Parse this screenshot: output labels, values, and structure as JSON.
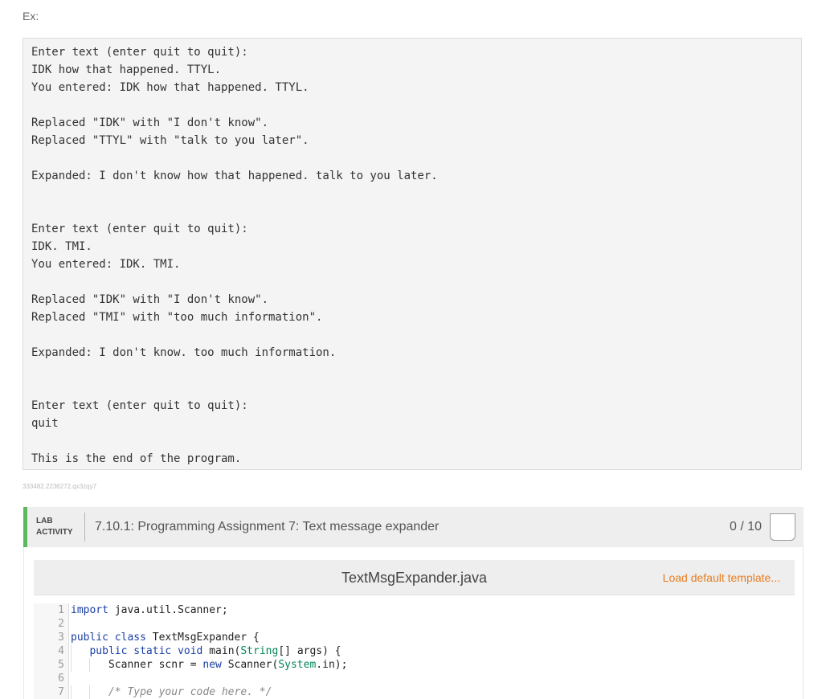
{
  "example_label": "Ex:",
  "console_lines": [
    "Enter text (enter quit to quit):",
    "IDK how that happened. TTYL.",
    "You entered: IDK how that happened. TTYL.",
    "",
    "Replaced \"IDK\" with \"I don't know\".",
    "Replaced \"TTYL\" with \"talk to you later\".",
    "",
    "Expanded: I don't know how that happened. talk to you later.",
    "",
    "",
    "Enter text (enter quit to quit):",
    "IDK. TMI.",
    "You entered: IDK. TMI.",
    "",
    "Replaced \"IDK\" with \"I don't know\".",
    "Replaced \"TMI\" with \"too much information\".",
    "",
    "Expanded: I don't know. too much information.",
    "",
    "",
    "Enter text (enter quit to quit):",
    "quit",
    "",
    "This is the end of the program."
  ],
  "lab_id": "333482.2236272.qx3zqy7",
  "lab": {
    "tag_line1": "LAB",
    "tag_line2": "ACTIVITY",
    "title": "7.10.1: Programming Assignment 7: Text message expander",
    "score": "0 / 10"
  },
  "editor": {
    "file_name": "TextMsgExpander.java",
    "load_template_label": "Load default template...",
    "code_lines": [
      {
        "num": "1",
        "text": "import java.util.Scanner;"
      },
      {
        "num": "2",
        "text": ""
      },
      {
        "num": "3",
        "text": "public class TextMsgExpander {"
      },
      {
        "num": "4",
        "text": "   public static void main(String[] args) {"
      },
      {
        "num": "5",
        "text": "      Scanner scnr = new Scanner(System.in);"
      },
      {
        "num": "6",
        "text": ""
      },
      {
        "num": "7",
        "text": "      /* Type your code here. */"
      }
    ]
  }
}
